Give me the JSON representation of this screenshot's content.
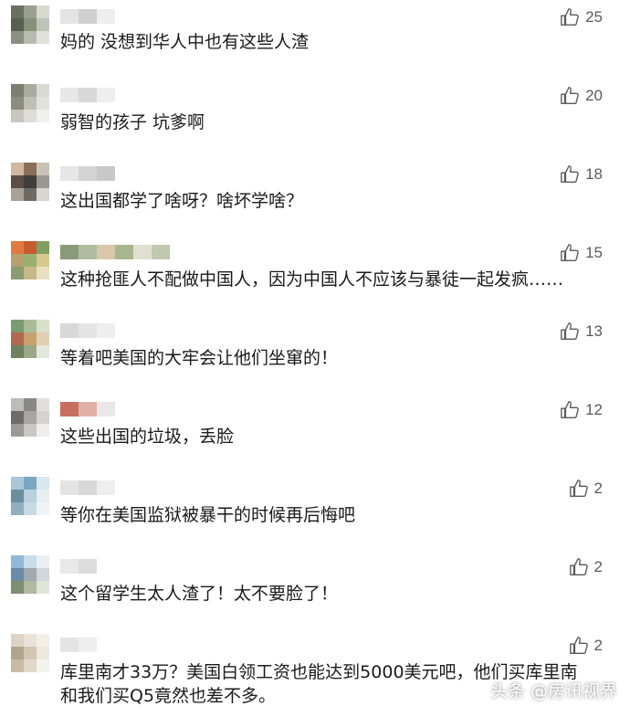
{
  "comments": [
    {
      "text": "妈的  没想到华人中也有这些人渣",
      "likes": "25",
      "avatar": [
        "#6a7060",
        "#9a9f90",
        "#d8dad0",
        "#55604f",
        "#88907a",
        "#c0c4b8",
        "#8a8f82",
        "#b8bcb0",
        "#e0e2da"
      ],
      "name": [
        "#e4e4e4",
        "#d0d0d0",
        "#eeeeee"
      ]
    },
    {
      "text": "弱智的孩子  坑爹啊",
      "likes": "20",
      "avatar": [
        "#7a7f72",
        "#a8ab9e",
        "#d9dad2",
        "#8d8a80",
        "#bfc0b5",
        "#e2e2dc",
        "#c8c6be",
        "#dedcd6",
        "#f0f0ec"
      ],
      "name": [
        "#e8e8e8",
        "#d8d8d8",
        "#eeeeee"
      ]
    },
    {
      "text": "这出国都学了啥呀？啥坏学啥？",
      "likes": "18",
      "avatar": [
        "#d0b8a0",
        "#8a6e58",
        "#c9c2b6",
        "#5c4e44",
        "#3e3e3a",
        "#9c978e",
        "#a8a298",
        "#6e6a64",
        "#d8d6d0"
      ],
      "name": [
        "#e6e6e6",
        "#d4d4d4",
        "#c8c8c8"
      ]
    },
    {
      "text": "这种抢匪人不配做中国人，因为中国人不应该与暴徒一起发疯……",
      "likes": "15",
      "avatar": [
        "#e07a40",
        "#c85a30",
        "#7ea060",
        "#b4a070",
        "#9ab070",
        "#d8c890",
        "#8c9c70",
        "#c6b888",
        "#e8e0c0"
      ],
      "name": [
        "#8a9a78",
        "#b0bca0",
        "#d6c8a8",
        "#a8b690",
        "#e0e0d0",
        "#c0c8b0"
      ]
    },
    {
      "text": "等着吧美国的大牢会让他们坐窜的！",
      "likes": "13",
      "avatar": [
        "#7a9a70",
        "#a8bc98",
        "#d8e0cc",
        "#b06a50",
        "#c8a070",
        "#e0d0b0",
        "#6e8060",
        "#9aa888",
        "#e4e8dc"
      ],
      "name": [
        "#d8d8d8",
        "#e4e4e4",
        "#eeeeee"
      ]
    },
    {
      "text": "这些出国的垃圾，丢脸",
      "likes": "12",
      "avatar": [
        "#bcbcb8",
        "#8a8884",
        "#e0dfdc",
        "#6e6c68",
        "#a8a6a2",
        "#d4d3d0",
        "#9c9a96",
        "#c8c7c4",
        "#efeeec"
      ],
      "name": [
        "#c87060",
        "#e0b0a8",
        "#e8e8e8"
      ]
    },
    {
      "text": "等你在美国监狱被暴干的时候再后悔吧",
      "likes": "2",
      "avatar": [
        "#a8c8d8",
        "#7aa8c0",
        "#d8e6ee",
        "#6a8e9e",
        "#b8d0dc",
        "#e6eef2",
        "#90aebe",
        "#c8dae4",
        "#eef4f6"
      ],
      "name": [
        "#e4e4e4",
        "#d8d8d8",
        "#eeeeee"
      ]
    },
    {
      "text": "这个留学生太人渣了！太不要脸了！",
      "likes": "2",
      "avatar": [
        "#90b8d8",
        "#c8dcea",
        "#e8f0f6",
        "#6a8aa8",
        "#a0a8b0",
        "#d0d6dc",
        "#7e8e70",
        "#b0b8a0",
        "#e0e4d8"
      ],
      "name": [
        "#e8e8e8",
        "#dcdcdc"
      ]
    },
    {
      "text": "库里南才33万？美国白领工资也能达到5000美元吧，他们买库里南",
      "text2": "和我们买Q5竟然也差不多。",
      "likes": "2",
      "avatar": [
        "#dcd4c4",
        "#e8e2d8",
        "#f2efe8",
        "#b0a48c",
        "#d0c6b2",
        "#ece8de",
        "#c8bca4",
        "#e0d8c8",
        "#f4f2ec"
      ],
      "name": [
        "#e4e4e4",
        "#eeeeee"
      ]
    }
  ],
  "watermark": "头条 @房讯视界"
}
